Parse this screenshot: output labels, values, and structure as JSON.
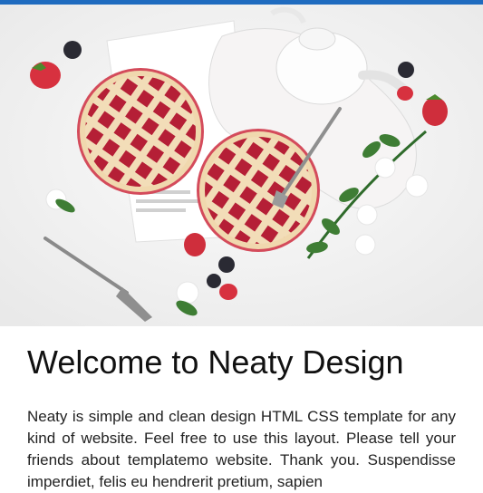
{
  "theme": {
    "accent": "#1f6bbf"
  },
  "hero": {
    "image_alt": "pies with berries and flowers"
  },
  "content": {
    "title": "Welcome to Neaty Design",
    "intro": "Neaty is simple and clean design HTML CSS template for any kind of website. Feel free to use this layout. Please tell your friends about templatemo website. Thank you. Suspendisse imperdiet, felis eu hendrerit pretium, sapien"
  }
}
